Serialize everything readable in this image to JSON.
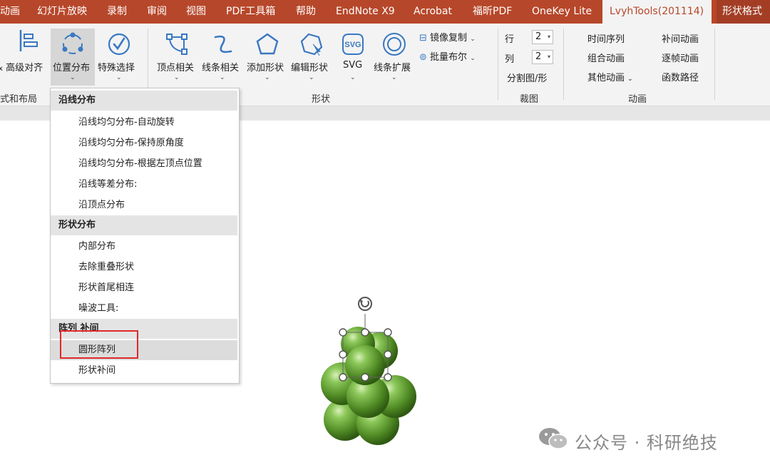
{
  "tabs": [
    {
      "label": "动画"
    },
    {
      "label": "幻灯片放映"
    },
    {
      "label": "录制"
    },
    {
      "label": "审阅"
    },
    {
      "label": "视图"
    },
    {
      "label": "PDF工具箱"
    },
    {
      "label": "帮助"
    },
    {
      "label": "EndNote X9"
    },
    {
      "label": "Acrobat"
    },
    {
      "label": "福昕PDF"
    },
    {
      "label": "OneKey Lite"
    },
    {
      "label": "LvyhTools(201114)"
    },
    {
      "label": "形状格式"
    }
  ],
  "ribbon": {
    "buttons": {
      "advanced_align": "高级对齐",
      "position_distribute": "位置分布",
      "special_select": "特殊选择",
      "vertex": "顶点相关",
      "line": "线条相关",
      "add_shape": "添加形状",
      "edit_shape": "编辑形状",
      "svg": "SVG",
      "line_extend": "线条扩展"
    },
    "small_buttons": {
      "mirror_copy": "镜像复制",
      "batch_boolean": "批量布尔"
    },
    "crop": {
      "row_label": "行",
      "row_value": "2",
      "col_label": "列",
      "col_value": "2",
      "split_label": "分割图/形"
    },
    "anim": {
      "time_series": "时间序列",
      "combo_anim": "组合动画",
      "other_anim": "其他动画",
      "tween_anim": "补间动画",
      "frame_anim": "逐帧动画",
      "func_path": "函数路径"
    },
    "groups": {
      "layout": "式和布局",
      "shape": "形状",
      "crop": "裁图",
      "anim": "动画"
    }
  },
  "menu": {
    "sections": [
      {
        "title": "沿线分布",
        "items": [
          "沿线均匀分布-自动旋转",
          "沿线均匀分布-保持原角度",
          "沿线均匀分布-根据左顶点位置",
          "沿线等差分布:",
          "沿顶点分布"
        ]
      },
      {
        "title": "形状分布",
        "items": [
          "内部分布",
          "去除重叠形状",
          "形状首尾相连",
          "噪波工具:"
        ]
      },
      {
        "title": "阵列 补间",
        "items": [
          "圆形阵列",
          "形状补间"
        ]
      }
    ]
  },
  "watermark": "公众号 · 科研绝技",
  "colors": {
    "accent": "#b7472a",
    "highlight": "#e02828",
    "sphere": "#6aa33a"
  }
}
